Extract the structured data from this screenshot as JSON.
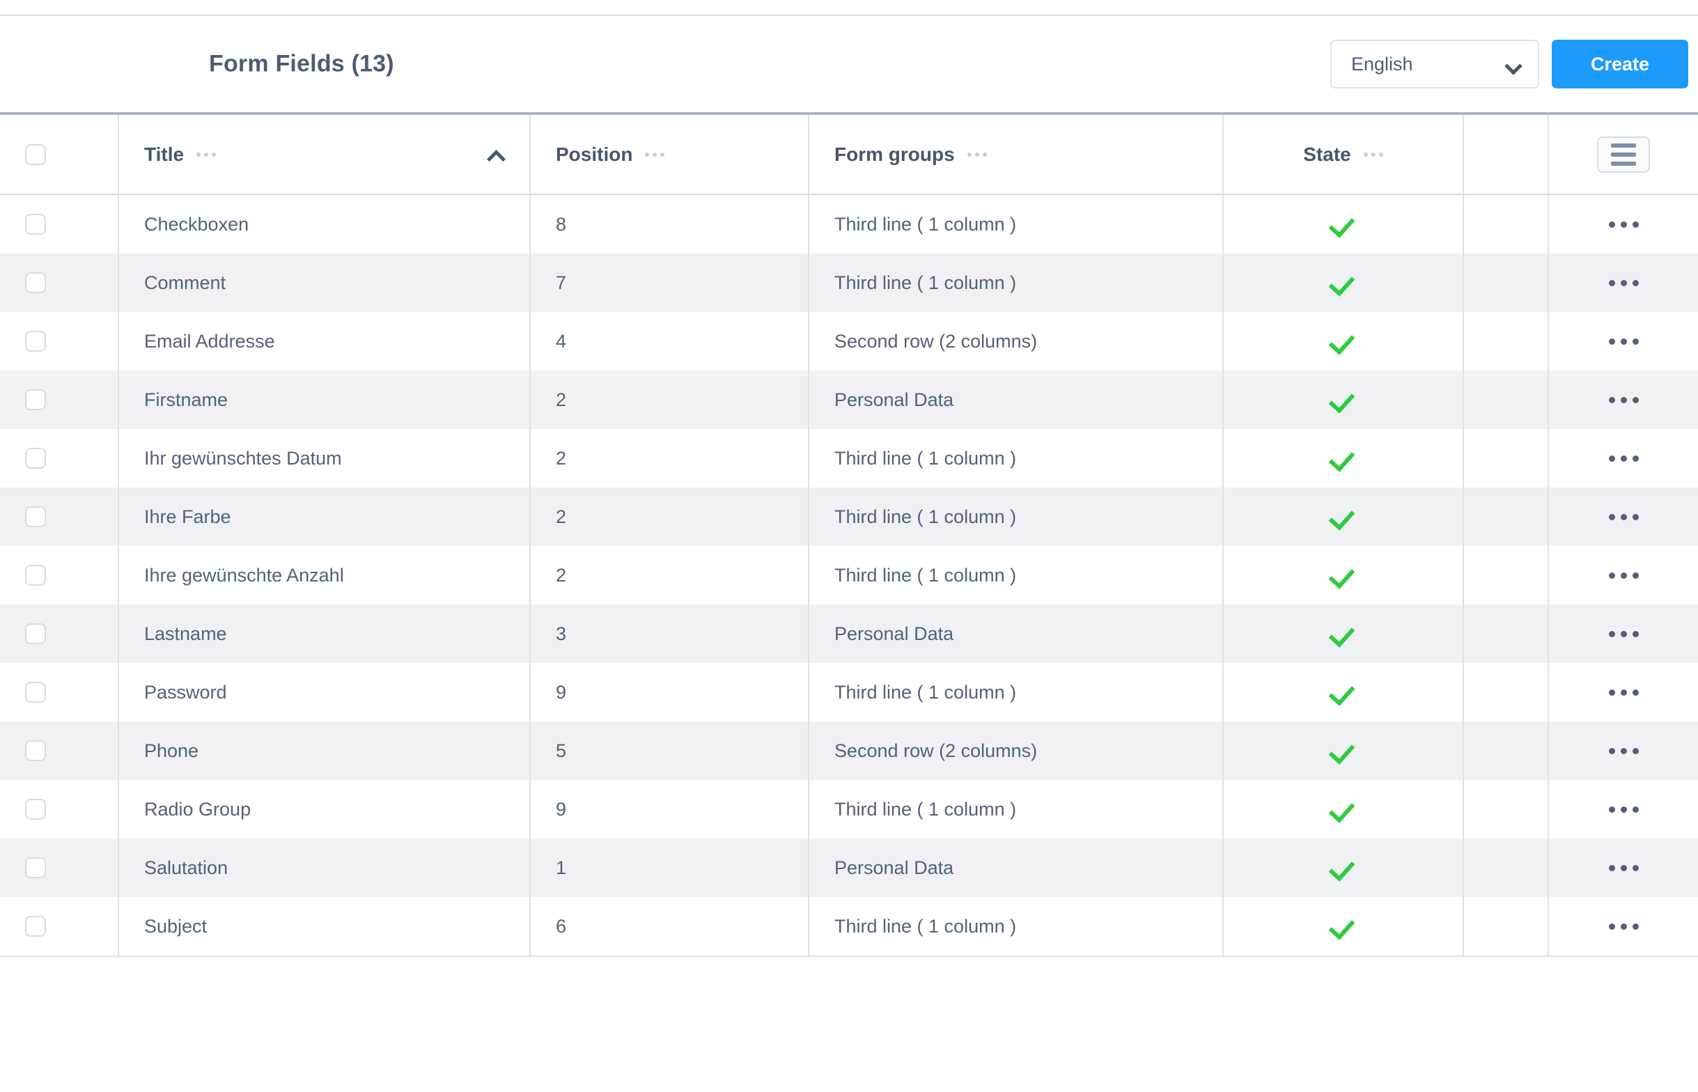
{
  "header": {
    "title": "Form Fields (13)",
    "language_select": {
      "value": "English",
      "icon": "chevron-down-icon"
    },
    "create_button": "Create",
    "menu_button_icon": "hamburger-icon"
  },
  "table": {
    "columns": [
      {
        "key": "select",
        "label": ""
      },
      {
        "key": "title",
        "label": "Title",
        "menu_icon": "ellipsis-icon",
        "sort": "asc",
        "sort_icon": "chevron-up-icon"
      },
      {
        "key": "position",
        "label": "Position",
        "menu_icon": "ellipsis-icon"
      },
      {
        "key": "form_groups",
        "label": "Form groups",
        "menu_icon": "ellipsis-icon"
      },
      {
        "key": "state",
        "label": "State",
        "menu_icon": "ellipsis-icon"
      },
      {
        "key": "spacer",
        "label": ""
      },
      {
        "key": "actions",
        "label": ""
      }
    ],
    "rows": [
      {
        "title": "Checkboxen",
        "position": "8",
        "form_groups": "Third line ( 1 column )",
        "state": "active",
        "state_icon": "check-icon",
        "actions_icon": "ellipsis-icon"
      },
      {
        "title": "Comment",
        "position": "7",
        "form_groups": "Third line ( 1 column )",
        "state": "active",
        "state_icon": "check-icon",
        "actions_icon": "ellipsis-icon"
      },
      {
        "title": "Email Addresse",
        "position": "4",
        "form_groups": "Second row (2 columns)",
        "state": "active",
        "state_icon": "check-icon",
        "actions_icon": "ellipsis-icon"
      },
      {
        "title": "Firstname",
        "position": "2",
        "form_groups": "Personal Data",
        "state": "active",
        "state_icon": "check-icon",
        "actions_icon": "ellipsis-icon"
      },
      {
        "title": "Ihr gewünschtes Datum",
        "position": "2",
        "form_groups": "Third line ( 1 column )",
        "state": "active",
        "state_icon": "check-icon",
        "actions_icon": "ellipsis-icon"
      },
      {
        "title": "Ihre Farbe",
        "position": "2",
        "form_groups": "Third line ( 1 column )",
        "state": "active",
        "state_icon": "check-icon",
        "actions_icon": "ellipsis-icon"
      },
      {
        "title": "Ihre gewünschte Anzahl",
        "position": "2",
        "form_groups": "Third line ( 1 column )",
        "state": "active",
        "state_icon": "check-icon",
        "actions_icon": "ellipsis-icon"
      },
      {
        "title": "Lastname",
        "position": "3",
        "form_groups": "Personal Data",
        "state": "active",
        "state_icon": "check-icon",
        "actions_icon": "ellipsis-icon"
      },
      {
        "title": "Password",
        "position": "9",
        "form_groups": "Third line ( 1 column )",
        "state": "active",
        "state_icon": "check-icon",
        "actions_icon": "ellipsis-icon"
      },
      {
        "title": "Phone",
        "position": "5",
        "form_groups": "Second row (2 columns)",
        "state": "active",
        "state_icon": "check-icon",
        "actions_icon": "ellipsis-icon"
      },
      {
        "title": "Radio Group",
        "position": "9",
        "form_groups": "Third line ( 1 column )",
        "state": "active",
        "state_icon": "check-icon",
        "actions_icon": "ellipsis-icon"
      },
      {
        "title": "Salutation",
        "position": "1",
        "form_groups": "Personal Data",
        "state": "active",
        "state_icon": "check-icon",
        "actions_icon": "ellipsis-icon"
      },
      {
        "title": "Subject",
        "position": "6",
        "form_groups": "Third line ( 1 column )",
        "state": "active",
        "state_icon": "check-icon",
        "actions_icon": "ellipsis-icon"
      }
    ]
  },
  "colors": {
    "accent": "#1d9bfc",
    "text": "#4b5c73",
    "check": "#2ecc3f",
    "stripe": "#eff1f5",
    "border": "#dde3ea"
  }
}
